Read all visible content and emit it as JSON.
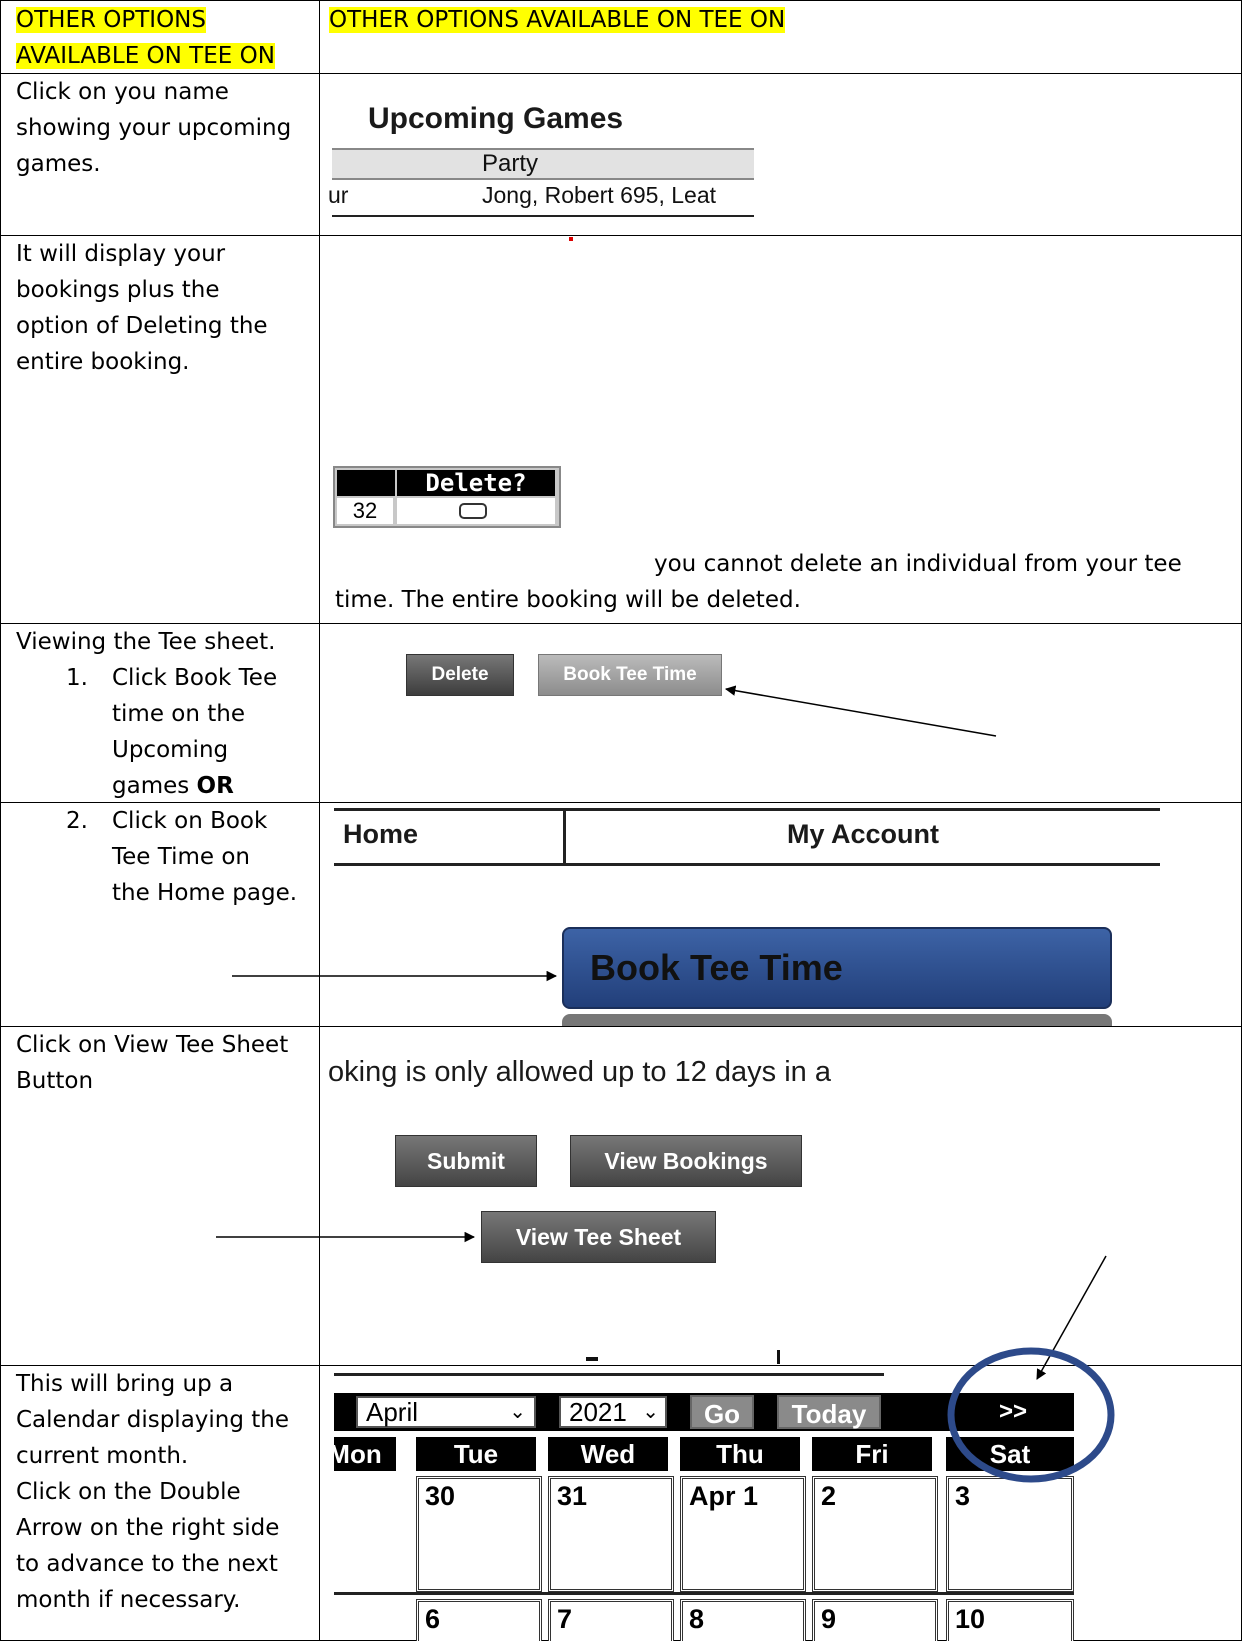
{
  "header": {
    "left": "OTHER OPTIONS AVAILABLE ON TEE ON",
    "left_line1": "OTHER OPTIONS",
    "left_line2": "AVAILABLE ON TEE ON",
    "right": "OTHER OPTIONS AVAILABLE ON TEE ON"
  },
  "row1": {
    "instruction": [
      "Click on you name",
      "showing your upcoming",
      "games."
    ],
    "panel_title": "Upcoming Games",
    "col_header": "Party",
    "cell_left": "ur",
    "cell_right": "Jong, Robert 695, Leat"
  },
  "row2": {
    "instruction": [
      "It will display your",
      "bookings plus the",
      "option of Deleting the",
      "entire booking."
    ],
    "table_header": "Delete?",
    "table_cell": "32",
    "note_line1": "you cannot delete an individual from your tee",
    "note_line2": "time. The entire booking will be deleted."
  },
  "row3": {
    "instruction_title": "Viewing the Tee sheet.",
    "step1_num": "1.",
    "step1_lines": [
      "Click Book Tee",
      "time on  the",
      "Upcoming"
    ],
    "step1_last": "games ",
    "step1_bold": "OR",
    "delete_button": "Delete",
    "book_button": "Book Tee Time"
  },
  "row4": {
    "step2_num": "2.",
    "step2_lines": [
      "Click on Book",
      "Tee Time on",
      "the Home page."
    ],
    "nav_home": "Home",
    "nav_account": "My Account",
    "book_tee_time": "Book Tee Time"
  },
  "row5": {
    "instruction": [
      "Click on View Tee Sheet",
      "Button"
    ],
    "notice": "oking is only allowed up to 12 days in a",
    "submit": "Submit",
    "view_bookings": "View Bookings",
    "view_tee_sheet": "View Tee Sheet"
  },
  "row6": {
    "instruction": [
      "This will bring up a",
      "Calendar displaying the",
      "current month.",
      "Click on the Double",
      "Arrow on the right side",
      "to advance to the next",
      "month if necessary."
    ],
    "month": "April",
    "year": "2021",
    "go": "Go",
    "today": "Today",
    "next": ">>",
    "days": [
      "Mon",
      "Tue",
      "Wed",
      "Thu",
      "Fri",
      "Sat"
    ],
    "week1": [
      "30",
      "31",
      "Apr 1",
      "2",
      "3"
    ],
    "week2": [
      "6",
      "7",
      "8",
      "9",
      "10"
    ]
  },
  "colors": {
    "highlight": "#ffff00",
    "book_blue": "#2e4f8f",
    "circle": "#2d4a8a"
  }
}
